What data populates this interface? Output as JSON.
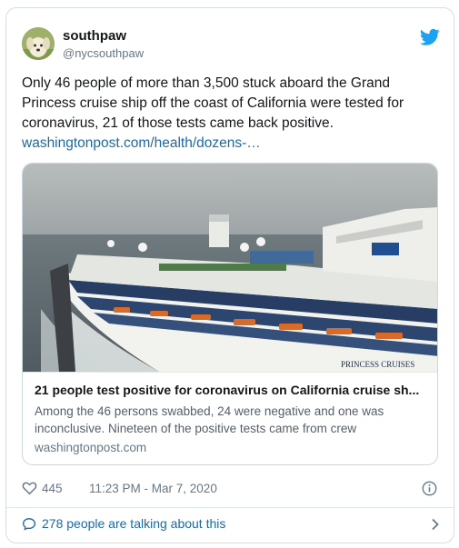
{
  "user": {
    "name": "southpaw",
    "handle": "@nycsouthpaw"
  },
  "tweet": {
    "text": "Only 46 people of more than 3,500 stuck aboard the Grand Princess cruise ship off the coast of California were tested for coronavirus, 21 of those tests came back positive.",
    "link": "washingtonpost.com/health/dozens-…"
  },
  "card": {
    "image_caption": "PRINCESS CRUISES",
    "title": "21 people test positive for coronavirus on California cruise sh...",
    "description": "Among the 46 persons swabbed, 24 were negative and one was inconclusive. Nineteen of the positive tests came from crew",
    "domain": "washingtonpost.com"
  },
  "meta": {
    "likes": "445",
    "timestamp": "11:23 PM - Mar 7, 2020"
  },
  "footer": {
    "talking": "278 people are talking about this"
  },
  "colors": {
    "link": "#1b6aa5",
    "twitter_blue": "#1da1f2",
    "secondary_text": "#657786"
  },
  "icons": [
    "twitter-bird-icon",
    "heart-icon",
    "info-icon",
    "speech-bubble-icon",
    "chevron-right-icon"
  ]
}
